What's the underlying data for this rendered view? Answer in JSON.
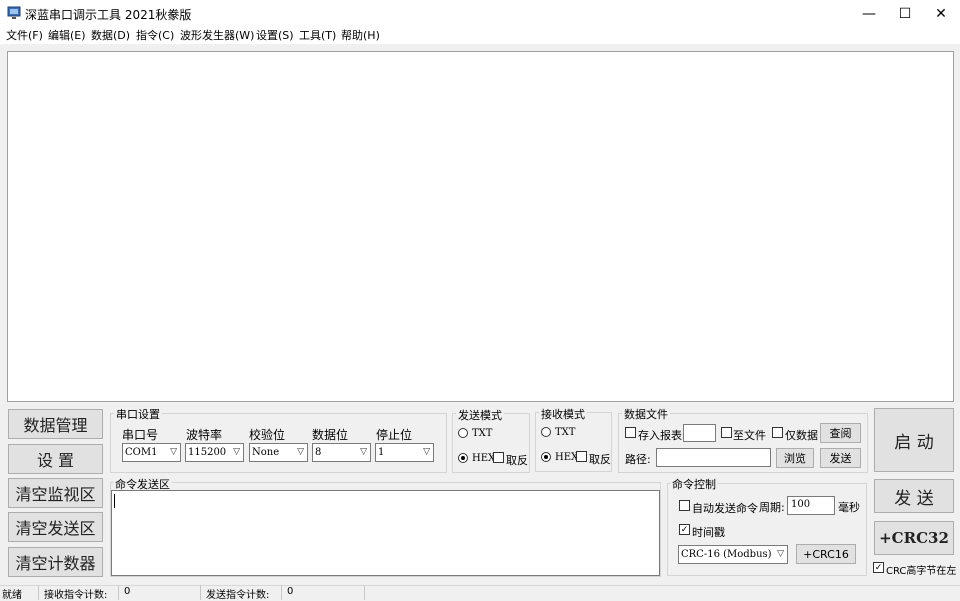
{
  "window": {
    "title": "深蓝串口调示工具 2021秋豢版"
  },
  "menu": [
    "文件(F)",
    "编辑(E)",
    "数据(D)",
    "指令(C)",
    "波形发生器(W)",
    "设置(S)",
    "工具(T)",
    "帮助(H)"
  ],
  "left_buttons": {
    "data_manage": "数据管理",
    "settings": "设 置",
    "clear_monitor": "清空监视区",
    "clear_send": "清空发送区",
    "clear_counter": "清空计数器"
  },
  "serial": {
    "group_title": "串口设置",
    "port_label": "串口号",
    "port_value": "COM1",
    "baud_label": "波特率",
    "baud_value": "115200",
    "parity_label": "校验位",
    "parity_value": "None",
    "databits_label": "数据位",
    "databits_value": "8",
    "stopbits_label": "停止位",
    "stopbits_value": "1"
  },
  "send_mode": {
    "title": "发送模式",
    "txt": "TXT",
    "hex": "HEX",
    "invert": "取反",
    "selected": "HEX"
  },
  "recv_mode": {
    "title": "接收模式",
    "txt": "TXT",
    "hex": "HEX",
    "invert": "取反",
    "selected": "HEX"
  },
  "data_file": {
    "title": "数据文件",
    "save_report": "存入报表",
    "save_report_value": "",
    "to_file": "至文件",
    "data_only": "仅数据",
    "query": "查阅",
    "path_label": "路径:",
    "path_value": "",
    "browse": "浏览",
    "send": "发送"
  },
  "command_area": {
    "title": "命令发送区",
    "text": ""
  },
  "command_control": {
    "title": "命令控制",
    "auto_send": "自动发送命令",
    "auto_send_checked": false,
    "period_label": "周期:",
    "period_value": "100",
    "unit": "毫秒",
    "timestamp": "时间戳",
    "timestamp_checked": true,
    "crc_mode": "CRC-16 (Modbus)",
    "crc16_button": "+CRC16"
  },
  "right_buttons": {
    "start": "启 动",
    "send": "发 送",
    "crc32": "+CRC32",
    "crc_high_left": "CRC高字节在左",
    "crc_high_left_checked": true
  },
  "status": {
    "ready": "就绪",
    "recv_label": "接收指令计数:",
    "recv_value": "0",
    "send_label": "发送指令计数:",
    "send_value": "0"
  }
}
